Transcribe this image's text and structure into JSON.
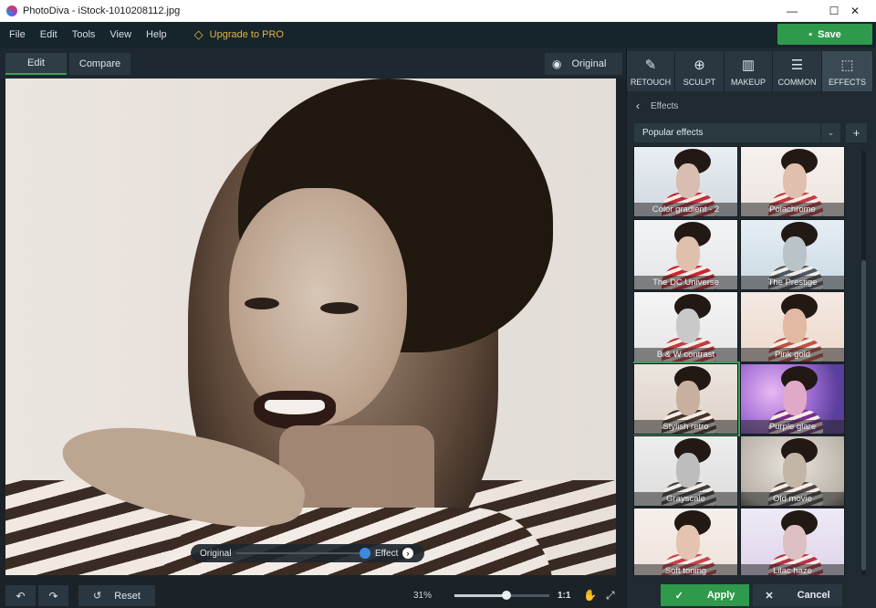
{
  "window": {
    "title": "PhotoDiva - iStock-1010208112.jpg",
    "controls": {
      "minimize": "—",
      "maximize": "☐",
      "close": "✕"
    }
  },
  "menu": {
    "items": [
      "File",
      "Edit",
      "Tools",
      "View",
      "Help"
    ],
    "upgrade_label": "Upgrade to PRO"
  },
  "save_label": "Save",
  "toolbar": {
    "edit_label": "Edit",
    "compare_label": "Compare",
    "original_label": "Original"
  },
  "compare_slider": {
    "original_label": "Original",
    "effect_label": "Effect"
  },
  "bottom": {
    "reset_label": "Reset",
    "zoom_label": "31%",
    "zoom_fraction": 0.55,
    "one_to_one": "1:1"
  },
  "right_tabs": [
    {
      "label": "RETOUCH",
      "icon": "retouch-icon"
    },
    {
      "label": "SCULPT",
      "icon": "sculpt-icon"
    },
    {
      "label": "MAKEUP",
      "icon": "makeup-icon"
    },
    {
      "label": "COMMON",
      "icon": "sliders-icon"
    },
    {
      "label": "EFFECTS",
      "icon": "effects-icon"
    }
  ],
  "effects": {
    "breadcrumb": "Effects",
    "dropdown_value": "Popular effects",
    "items": [
      {
        "label": "Color gradient - 2"
      },
      {
        "label": "Polachrome"
      },
      {
        "label": "The DC Universe"
      },
      {
        "label": "The Prestige"
      },
      {
        "label": "B & W contrast"
      },
      {
        "label": "Pink gold"
      },
      {
        "label": "Stylish retro"
      },
      {
        "label": "Purple glare"
      },
      {
        "label": "Grayscale"
      },
      {
        "label": "Old movie"
      },
      {
        "label": "Soft toning"
      },
      {
        "label": "Lilac haze"
      }
    ]
  },
  "apply_label": "Apply",
  "cancel_label": "Cancel"
}
